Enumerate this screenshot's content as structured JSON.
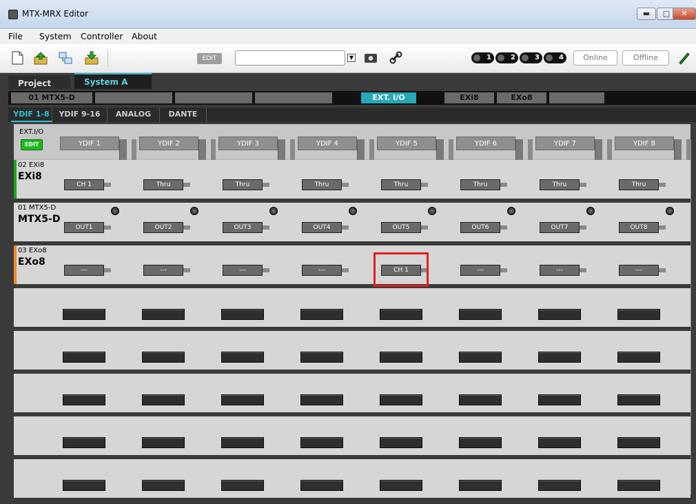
{
  "window": {
    "title": "MTX-MRX Editor"
  },
  "menu": [
    "File",
    "System",
    "Controller",
    "About"
  ],
  "toolbar": {
    "edit_label": "EDIT",
    "combo_value": "",
    "pills": [
      "1",
      "2",
      "3",
      "4"
    ],
    "online_label": "Online",
    "offline_label": "Offline"
  },
  "project_tabs": [
    "Project",
    "System A"
  ],
  "devices": [
    "01 MTX5-D",
    "",
    "",
    "",
    "EXT. I/O",
    "EXi8",
    "EXo8",
    ""
  ],
  "sub_tabs": [
    "YDIF 1-8",
    "YDIF 9-16",
    "ANALOG",
    "DANTE"
  ],
  "grid": {
    "ext_io_label": "EXT.I/O",
    "edit_button": "EDIT",
    "columns": [
      "YDIF 1",
      "YDIF 2",
      "YDIF 3",
      "YDIF 4",
      "YDIF 5",
      "YDIF 6",
      "YDIF 7",
      "YDIF 8"
    ],
    "rows": [
      {
        "id": "02 EXi8",
        "name": "EXi8",
        "strip_color": "#1aa81a",
        "cells": [
          "CH 1",
          "Thru",
          "Thru",
          "Thru",
          "Thru",
          "Thru",
          "Thru",
          "Thru"
        ]
      },
      {
        "id": "01 MTX5-D",
        "name": "MTX5-D",
        "strip_color": "",
        "cells": [
          "OUT1",
          "OUT2",
          "OUT3",
          "OUT4",
          "OUT5",
          "OUT6",
          "OUT7",
          "OUT8"
        ]
      },
      {
        "id": "03 EXo8",
        "name": "EXo8",
        "strip_color": "#f08c1c",
        "cells": [
          "---",
          "---",
          "---",
          "---",
          "CH 1",
          "---",
          "---",
          "---"
        ]
      }
    ],
    "empty_row_count": 5,
    "highlight_color": "#e0201a"
  }
}
